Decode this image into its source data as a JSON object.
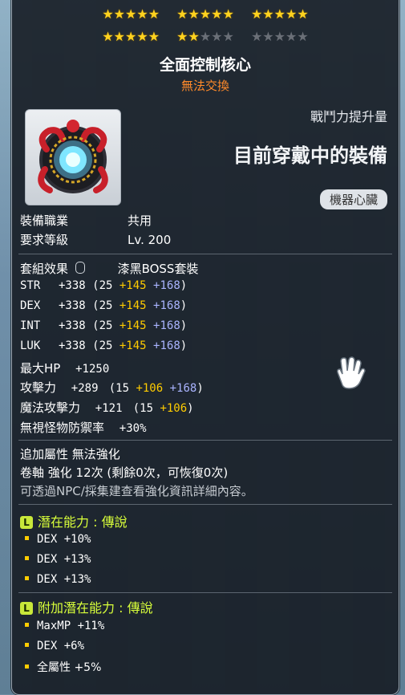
{
  "stars": {
    "row1": [
      5,
      5,
      5
    ],
    "row2": [
      {
        "on": 5,
        "off": 0
      },
      {
        "on": 2,
        "off": 3
      },
      {
        "on": 0,
        "off": 5
      }
    ]
  },
  "item": {
    "name": "全面控制核心",
    "trade": "無法交換",
    "power_label": "戰鬥力提升量",
    "equipped_text": "目前穿戴中的裝備",
    "slot": "機器心臟"
  },
  "req": {
    "job_label": "裝備職業",
    "job_value": "共用",
    "level_label": "要求等級",
    "level_value": "Lv. 200"
  },
  "set": {
    "label": "套組效果",
    "value": "漆黑BOSS套裝"
  },
  "stats": [
    {
      "name": "STR",
      "total": "+338",
      "base": "25",
      "bonus": "+145",
      "star": "+168"
    },
    {
      "name": "DEX",
      "total": "+338",
      "base": "25",
      "bonus": "+145",
      "star": "+168"
    },
    {
      "name": "INT",
      "total": "+338",
      "base": "25",
      "bonus": "+145",
      "star": "+168"
    },
    {
      "name": "LUK",
      "total": "+338",
      "base": "25",
      "bonus": "+145",
      "star": "+168"
    }
  ],
  "maxhp": {
    "label": "最大HP",
    "value": "+1250"
  },
  "atk": {
    "label": "攻擊力",
    "total": "+289",
    "base": "15",
    "bonus": "+106",
    "star": "+168"
  },
  "matk": {
    "label": "魔法攻擊力",
    "total": "+121",
    "base": "15",
    "bonus": "+106"
  },
  "ied": {
    "label": "無視怪物防禦率",
    "value": "+30%"
  },
  "flags": {
    "addopt": "追加屬性 無法強化",
    "scroll": "卷軸 強化 12次 (剩餘0次，可恢復0次)",
    "hint": "可透過NPC/採集建查看強化資訊詳細內容。"
  },
  "potential": {
    "badge": "L",
    "head": "潛在能力 : 傳說",
    "lines": [
      "DEX +10%",
      "DEX +13%",
      "DEX +13%"
    ]
  },
  "bonus_potential": {
    "badge": "L",
    "head": "附加潛在能力 : 傳說",
    "lines": [
      "MaxMP +11%",
      "DEX +6%",
      "全屬性 +5%"
    ]
  },
  "colors": {
    "gold": "#ffcc00",
    "blue": "#aab4ff",
    "legendary": "#d9ff3a",
    "trade": "#ff8a2a"
  }
}
